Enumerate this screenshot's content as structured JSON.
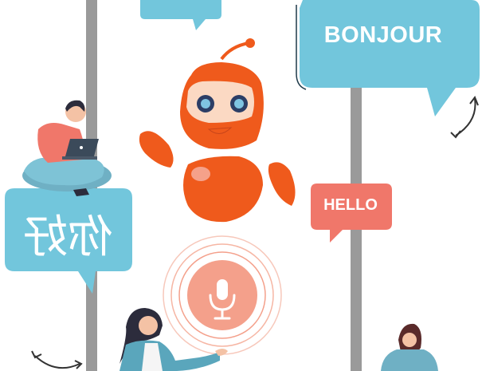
{
  "bubbles": {
    "bonjour": "BONJOUR",
    "hello": "HELLO",
    "nihao": "你好"
  },
  "colors": {
    "bubble_blue": "#72c6dc",
    "bubble_salmon": "#f0776a",
    "robot_orange": "#ef5a1c",
    "pole_gray": "#9a9a9a",
    "mic_pink": "#f4a08b"
  },
  "icons": [
    "microphone-icon",
    "rotate-arrow-icon",
    "laptop-icon"
  ]
}
